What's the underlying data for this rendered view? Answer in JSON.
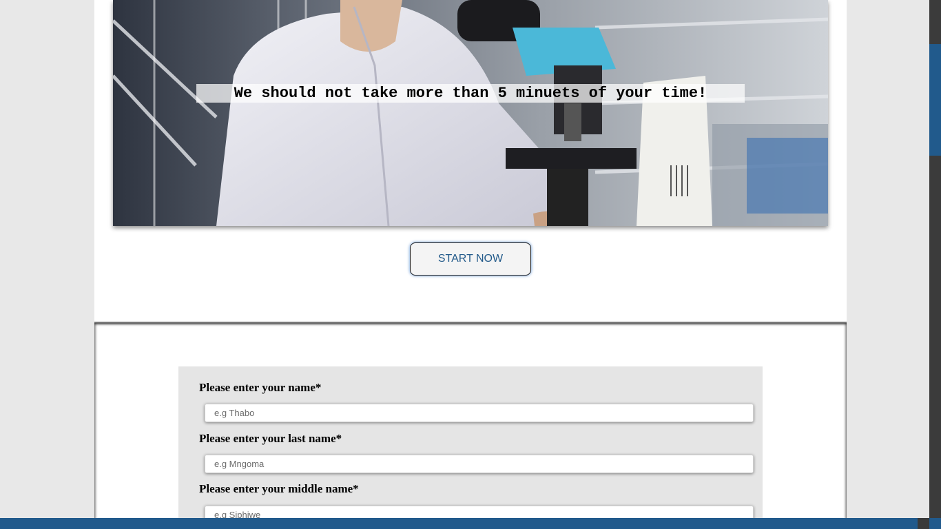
{
  "hero": {
    "caption": "We should not take more than 5 minuets of your time!",
    "image_description_icon": "lab-scientist-microscope-photo"
  },
  "cta": {
    "start_label": "START NOW"
  },
  "form": {
    "fields": [
      {
        "label": "Please enter your name*",
        "placeholder": "e.g Thabo"
      },
      {
        "label": "Please enter your last name*",
        "placeholder": "e.g Mngoma"
      },
      {
        "label": "Please enter your middle name*",
        "placeholder": "e.g Siphiwe"
      }
    ]
  },
  "colors": {
    "accent": "#215a8c",
    "button_text": "#225a8a",
    "form_background": "#e5e5e5",
    "page_background": "#e8e8e8"
  }
}
